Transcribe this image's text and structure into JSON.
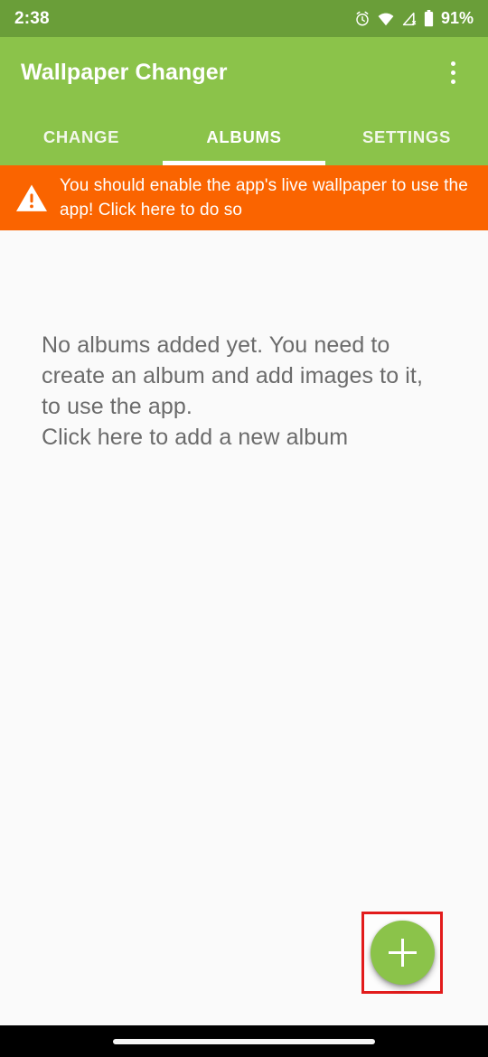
{
  "status_bar": {
    "time": "2:38",
    "battery_percent": "91%",
    "icons": [
      "alarm-icon",
      "wifi-icon",
      "cell-signal-off-icon",
      "battery-icon"
    ]
  },
  "app_bar": {
    "title": "Wallpaper Changer",
    "overflow_icon": "more-vert-icon"
  },
  "tabs": [
    {
      "label": "CHANGE",
      "active": false
    },
    {
      "label": "ALBUMS",
      "active": true
    },
    {
      "label": "SETTINGS",
      "active": false
    }
  ],
  "warning_banner": {
    "icon": "warning-triangle-icon",
    "text": "You should enable the app's live wallpaper to use the app! Click here to do so",
    "background_color": "#fa6400"
  },
  "main": {
    "empty_state_line1": "No albums added yet. You need to create an album and add images to it, to use the app.",
    "empty_state_line2": "Click here to add a new album"
  },
  "fab": {
    "icon": "plus-icon",
    "label": "Add album",
    "color": "#8bc34a",
    "highlight_color": "#e21b1b"
  },
  "nav_bar": {
    "handle": "gesture-pill"
  },
  "theme": {
    "primary": "#8bc34a",
    "primary_dark": "#6a9e39",
    "accent_orange": "#fa6400",
    "background": "#fafafa",
    "text_secondary": "#6b6b6b"
  }
}
